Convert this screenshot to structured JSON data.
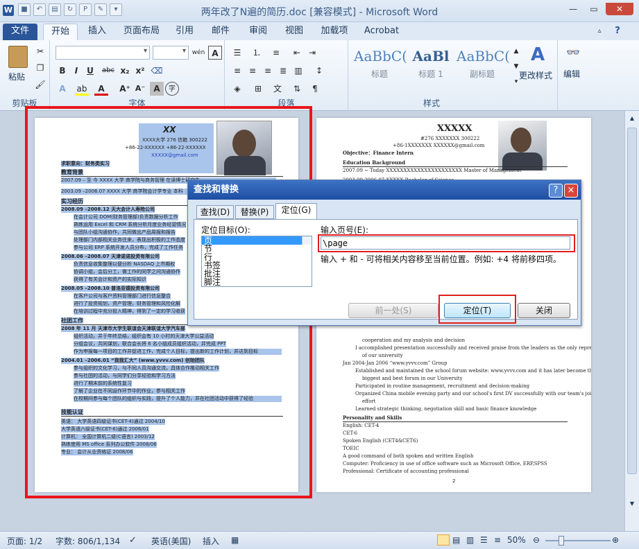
{
  "window": {
    "title": "两年改了N遍的简历.doc [兼容模式] - Microsoft Word"
  },
  "tabs": [
    "文件",
    "开始",
    "插入",
    "页面布局",
    "引用",
    "邮件",
    "审阅",
    "视图",
    "加载项",
    "Acrobat"
  ],
  "ribbon": {
    "clipboard_label": "剪贴板",
    "paste_label": "粘贴",
    "font_label": "字体",
    "paragraph_label": "段落",
    "styles_label": "样式",
    "style_samples": [
      {
        "sample": "AaBbC(",
        "name": "标题"
      },
      {
        "sample": "AaBl",
        "name": "标题 1"
      },
      {
        "sample": "AaBbC(",
        "name": "副标题"
      }
    ],
    "change_styles_label": "更改样式",
    "edit_label": "编辑"
  },
  "doc_left": {
    "name": "XX",
    "contact1": "XXXX大学 276 信箱          300222",
    "contact2": "+86-22-XXXXXX     +86-22-XXXXXX",
    "email": "XXXXX@gmail.com",
    "goal": "求职意向：财务类实习",
    "sections": [
      "教育背景",
      "实习经历",
      "社团工作",
      "技能认证"
    ],
    "lines": [
      "2007.09 – 至 今      XXXX 大学 商学院与商务管理 在读博士研究生",
      "2003.09 –2006.07     XXXX 大学  商学院会计学专业  本科",
      "2008.09 –2008.12     天大会计人寿险公司",
      "在会计公司 DOM(财务管理部)负责数据分析工作",
      "熟练运用 Excel 和 CRM 系统分析月度业务经营情况",
      "与团队小组沟通协作，共同做出产品周报和报告",
      "处理部门内部相关业务往来，表现出积极的工作态度",
      "参与公司 ERP 系统开发人员分布，完成了工作任务",
      "2008.06 –2008.07     天津诺诺投资有限公司",
      "负责信息收集整理以便分析 NASDAQ 上市期权",
      "协调小组，会后分工，做工作的同学之间沟通协作",
      "获得了有关会计和资产的实际知识",
      "2008.05 –2008.10     普洛亚德投资有限公司",
      "在客户公司与客户资料管理部门进行信息整合",
      "进行了投资规划，资产管理，财务管理和风险化解",
      "在培训过程中充分投入精神，得到了一定的学习收获",
      "2008 年 11 月     天津市大学生联谊会天津联谊大学汽车部",
      "组织活动，并于年终总结，组织会有 10 小时的天津大学公益活动",
      "分组会议，共同谋划，联合会长将 6 名小组成员组织活动，并完成 PPT",
      "作为申报每一项目的工作并促进工作，完成个人目标，提出新的工作计划，并达到目标",
      "2004.01 –2006.01     “我我汇大” (www.yvvv.com) 创始团队",
      "参与组织的文化学习，与不同人员沟通交流，具体合作推动相关工作",
      "参与社团的活动，与同学们分享经验和学习方法",
      "进行了期末前的系统性复习",
      "了解了企业在不同运作环节中的作业，参与相关工作",
      "在校期间参与每个团队的组织与实践，提升了个人能力，并在社团活动中获得了经验",
      "英语：       大学英语四级证书(CET-4)通过              2004/10",
      "                 大学英语六级证书(CET-6)通过              2006/01",
      "计算机：    全国计算机二级(C语言)                          2003/12",
      "                 熟练使用 MS office 系列办公软件           2008/06",
      "专业：       会计从业资格证                                      2008/06"
    ]
  },
  "doc_right": {
    "name": "XXXXX",
    "address": "#276 XXXXXXX          300222",
    "phones": "+86-1XXXXXXX          XXXXXX@gmail.com",
    "objective": "Objective：Finance Intern",
    "edu_heading": "Education Background",
    "edu_line1": "2007.09 ~ Today    XXXXXXXXXXXXXXXXXXXXXX         Master of Management",
    "edu_line2": "2003.09-2006.07  XXXXX                                            Bachelor of Science",
    "body_lines": [
      "cooperation and my analysis and decision",
      "I accomplished presentation successfully and received praise from the leaders as the only representative",
      "of our university",
      "Jan 2004-Jan 2006      “www.yvvv.com” Group",
      "Established and maintained the school forum website: www.yvvv.com and it has later become the",
      "biggest and best forum in our University",
      "Participated in routine management, recruitment and decision-making",
      "Organized China mobile evening party and our school's first DV successfully with our team's joint",
      "effort",
      "Learned strategic thinking, negotiation skill and basic finance knowledge"
    ],
    "skills_heading": "Personality and Skills",
    "skills": [
      "English:        CET-4",
      "                     CET-6",
      "                     Spoken English (CET4&CET6)",
      "                     TOEIC",
      "                     A good command of both spoken and written English",
      "Computer:     Proficiency in use of office software such as Microsoft Office, ERP,SPSS",
      "Professional:  Certificate of accounting professional"
    ],
    "page_no": "2"
  },
  "dialog": {
    "title": "查找和替换",
    "help": "?",
    "close": "×",
    "tabs": [
      "查找(D)",
      "替换(P)",
      "定位(G)"
    ],
    "goto_what_label": "定位目标(O):",
    "goto_items": [
      "页",
      "节",
      "行",
      "书签",
      "批注",
      "脚注"
    ],
    "page_number_label": "输入页号(E):",
    "page_input_value": "\\page",
    "hint": "输入 + 和 - 可将相关内容移至当前位置。例如: +4 将前移四项。",
    "prev_label": "前一处(S)",
    "goto_label": "定位(T)",
    "close_label": "关闭"
  },
  "status": {
    "page": "页面: 1/2",
    "words": "字数: 806/1,134",
    "language": "英语(美国)",
    "insert": "插入",
    "zoom": "50%",
    "zoom_level_pct": 50
  }
}
